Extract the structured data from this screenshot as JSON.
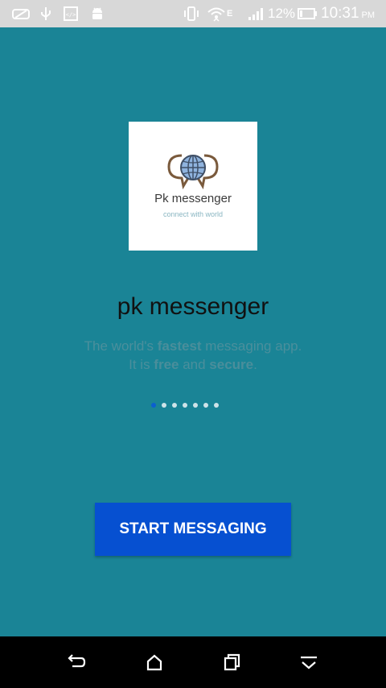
{
  "status_bar": {
    "battery_percent": "12%",
    "time": "10:31",
    "ampm": "PM",
    "network": "E",
    "icons": [
      "vr-icon",
      "usb-icon",
      "developer-icon",
      "android-icon",
      "vibrate-icon",
      "wifi-icon",
      "signal-icon",
      "battery-icon"
    ]
  },
  "logo": {
    "title": "Pk messenger",
    "tagline": "connect with world"
  },
  "app": {
    "title": "pk messenger"
  },
  "description": {
    "line1_part1": "The world's ",
    "line1_bold": "fastest",
    "line1_part2": " messaging app.",
    "line2_part1": "It is ",
    "line2_bold1": "free",
    "line2_part2": " and ",
    "line2_bold2": "secure",
    "line2_part3": "."
  },
  "pager": {
    "count": 7,
    "active_index": 0
  },
  "start_button": {
    "label": "START MESSAGING"
  },
  "navbar": {
    "icons": [
      "back-icon",
      "home-icon",
      "recents-icon",
      "hide-keyboard-icon"
    ]
  },
  "colors": {
    "background": "#1a8496",
    "button": "#0650d1",
    "active_dot": "#0b5fd0"
  }
}
